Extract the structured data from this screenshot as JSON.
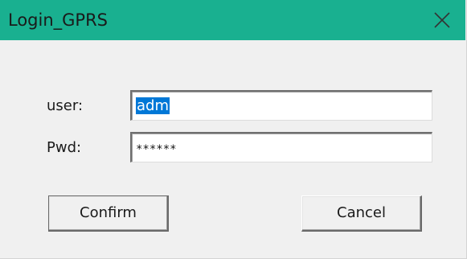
{
  "window": {
    "title": "Login_GPRS",
    "titlebar_color": "#19b090",
    "close_icon": "close-icon"
  },
  "form": {
    "user_label": "user:",
    "user_value": "adm",
    "pwd_label": "Pwd:",
    "pwd_value": "******"
  },
  "buttons": {
    "confirm_label": "Confirm",
    "cancel_label": "Cancel"
  },
  "colors": {
    "selection": "#0078d7",
    "background": "#f0f0f0"
  }
}
